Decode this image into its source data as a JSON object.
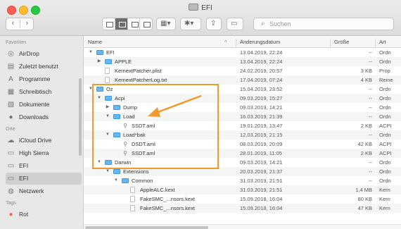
{
  "window": {
    "title": "EFI"
  },
  "toolbar": {
    "back_icon": "chevron-left-icon",
    "forward_icon": "chevron-right-icon",
    "search_placeholder": "Suchen"
  },
  "sidebar": {
    "section_favorites": "Favoriten",
    "favorites": [
      {
        "icon": "airdrop-icon",
        "label": "AirDrop"
      },
      {
        "icon": "recents-icon",
        "label": "Zuletzt benutzt"
      },
      {
        "icon": "applications-icon",
        "label": "Programme"
      },
      {
        "icon": "desktop-icon",
        "label": "Schreibtisch"
      },
      {
        "icon": "documents-icon",
        "label": "Dokumente"
      },
      {
        "icon": "downloads-icon",
        "label": "Downloads"
      }
    ],
    "section_locations": "Orte",
    "locations": [
      {
        "icon": "icloud-icon",
        "label": "iCloud Drive",
        "active": false
      },
      {
        "icon": "disk-icon",
        "label": "High Sierra",
        "active": false
      },
      {
        "icon": "disk-icon",
        "label": "EFI",
        "active": false
      },
      {
        "icon": "disk-icon",
        "label": "EFI",
        "active": true
      },
      {
        "icon": "network-icon",
        "label": "Netzwerk",
        "active": false
      }
    ],
    "section_tags": "Tags",
    "tags": [
      {
        "label": "Rot",
        "color": "#fd5f57"
      }
    ]
  },
  "columns": {
    "name": "Name",
    "date": "Änderungsdatum",
    "size": "Größe",
    "kind": "Art",
    "sort_indicator": "^"
  },
  "rows": [
    {
      "level": 0,
      "disclosure": "open",
      "icon": "folder",
      "name": "EFI",
      "date": "13.04.2019, 22:24",
      "size": "--",
      "kind": "Ordn"
    },
    {
      "level": 1,
      "disclosure": "closed",
      "icon": "folder",
      "name": "APPLE",
      "date": "13.04.2019, 22:24",
      "size": "--",
      "kind": "Ordn"
    },
    {
      "level": 1,
      "disclosure": "none",
      "icon": "file",
      "name": "KernextPatcher.plist",
      "date": "24.02.2019, 20:57",
      "size": "3 KB",
      "kind": "Prop"
    },
    {
      "level": 1,
      "disclosure": "none",
      "icon": "file",
      "name": "KernextPatcherLog.txt",
      "date": "17.04.2019, 07:24",
      "size": "4 KB",
      "kind": "Reine"
    },
    {
      "level": 0,
      "disclosure": "open",
      "icon": "folder",
      "name": "Oz",
      "date": "15.04.2019, 23:52",
      "size": "--",
      "kind": "Ordn"
    },
    {
      "level": 1,
      "disclosure": "open",
      "icon": "folder",
      "name": "Acpi",
      "date": "09.03.2019, 15:27",
      "size": "--",
      "kind": "Ordn"
    },
    {
      "level": 2,
      "disclosure": "closed",
      "icon": "folder",
      "name": "Dump",
      "date": "09.03.2019, 14:21",
      "size": "--",
      "kind": "Ordn"
    },
    {
      "level": 2,
      "disclosure": "open",
      "icon": "folder",
      "name": "Load",
      "date": "16.03.2019, 21:39",
      "size": "--",
      "kind": "Ordn"
    },
    {
      "level": 3,
      "disclosure": "none",
      "icon": "aml",
      "name": "SSDT.aml",
      "date": "19.01.2019, 13:47",
      "size": "2 KB",
      "kind": "ACPI"
    },
    {
      "level": 2,
      "disclosure": "open",
      "icon": "folder",
      "name": "Load*bak",
      "date": "12.03.2019, 21:15",
      "size": "--",
      "kind": "Ordn"
    },
    {
      "level": 3,
      "disclosure": "none",
      "icon": "aml",
      "name": "DSDT.aml",
      "date": "08.03.2019, 20:09",
      "size": "42 KB",
      "kind": "ACPI"
    },
    {
      "level": 3,
      "disclosure": "none",
      "icon": "aml",
      "name": "SSDT.aml",
      "date": "28.01.2019, 11:05",
      "size": "2 KB",
      "kind": "ACPI"
    },
    {
      "level": 1,
      "disclosure": "open",
      "icon": "folder",
      "name": "Darwin",
      "date": "09.03.2019, 14:21",
      "size": "--",
      "kind": "Ordn"
    },
    {
      "level": 2,
      "disclosure": "open",
      "icon": "folder",
      "name": "Extensions",
      "date": "20.03.2019, 21:37",
      "size": "--",
      "kind": "Ordn"
    },
    {
      "level": 3,
      "disclosure": "open",
      "icon": "folder",
      "name": "Common",
      "date": "31.03.2019, 21:51",
      "size": "--",
      "kind": "Ordn"
    },
    {
      "level": 4,
      "disclosure": "none",
      "icon": "kext",
      "name": "AppleALC.kext",
      "date": "31.03.2019, 21:51",
      "size": "1,4 MB",
      "kind": "Kern"
    },
    {
      "level": 4,
      "disclosure": "none",
      "icon": "kext",
      "name": "FakeSMC_...nsors.kext",
      "date": "15.09.2018, 16:04",
      "size": "80 KB",
      "kind": "Kern"
    },
    {
      "level": 4,
      "disclosure": "none",
      "icon": "kext",
      "name": "FakeSMC_...nsors.kext",
      "date": "15.09.2018, 16:04",
      "size": "47 KB",
      "kind": "Kern"
    }
  ],
  "annotation": {
    "color": "#f29a2e"
  }
}
